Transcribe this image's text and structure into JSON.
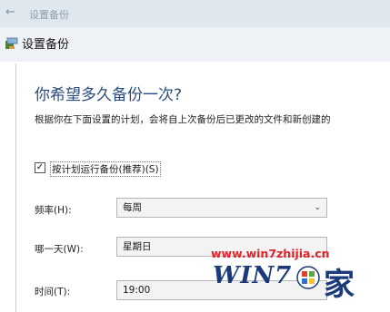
{
  "window": {
    "top_title": "设置备份",
    "title": "设置备份"
  },
  "main": {
    "heading": "你希望多久备份一次?",
    "description": "根据你在下面设置的计划，会将自上次备份后已更改的文件和新创建的"
  },
  "schedule": {
    "checkbox_label": "按计划运行备份(推荐)(S)",
    "checked": true
  },
  "fields": [
    {
      "label": "频率(H):",
      "value": "每周"
    },
    {
      "label": "哪一天(W):",
      "value": "星期日"
    },
    {
      "label": "时间(T):",
      "value": "19:00"
    }
  ],
  "watermark": {
    "url": "www.win7zhijia.cn",
    "logo": "WIN7",
    "char": "家"
  },
  "colors": {
    "heading": "#2a4c7c",
    "watermark_url": "#e3232a",
    "watermark_logo": "#1b3a7a"
  }
}
